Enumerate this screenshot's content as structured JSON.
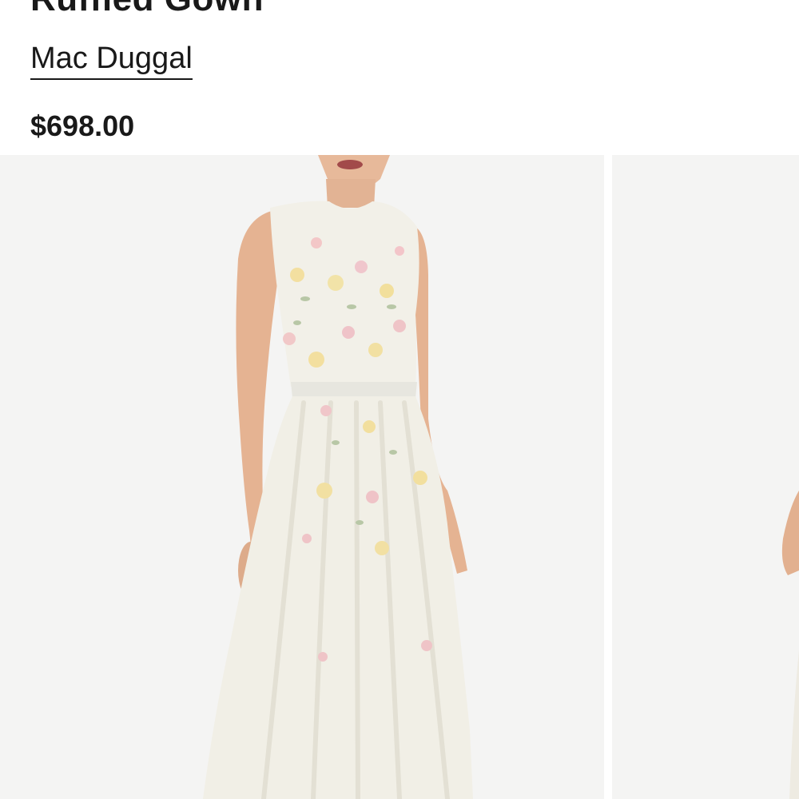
{
  "product": {
    "title": "Ruffled Gown",
    "brand": "Mac Duggal",
    "price": "$698.00"
  },
  "gallery": {
    "images": [
      {
        "name": "product-image-front"
      },
      {
        "name": "product-image-next"
      }
    ]
  },
  "colors": {
    "text": "#191919",
    "image_background": "#f4f4f3",
    "gown": "#f1efe6"
  }
}
